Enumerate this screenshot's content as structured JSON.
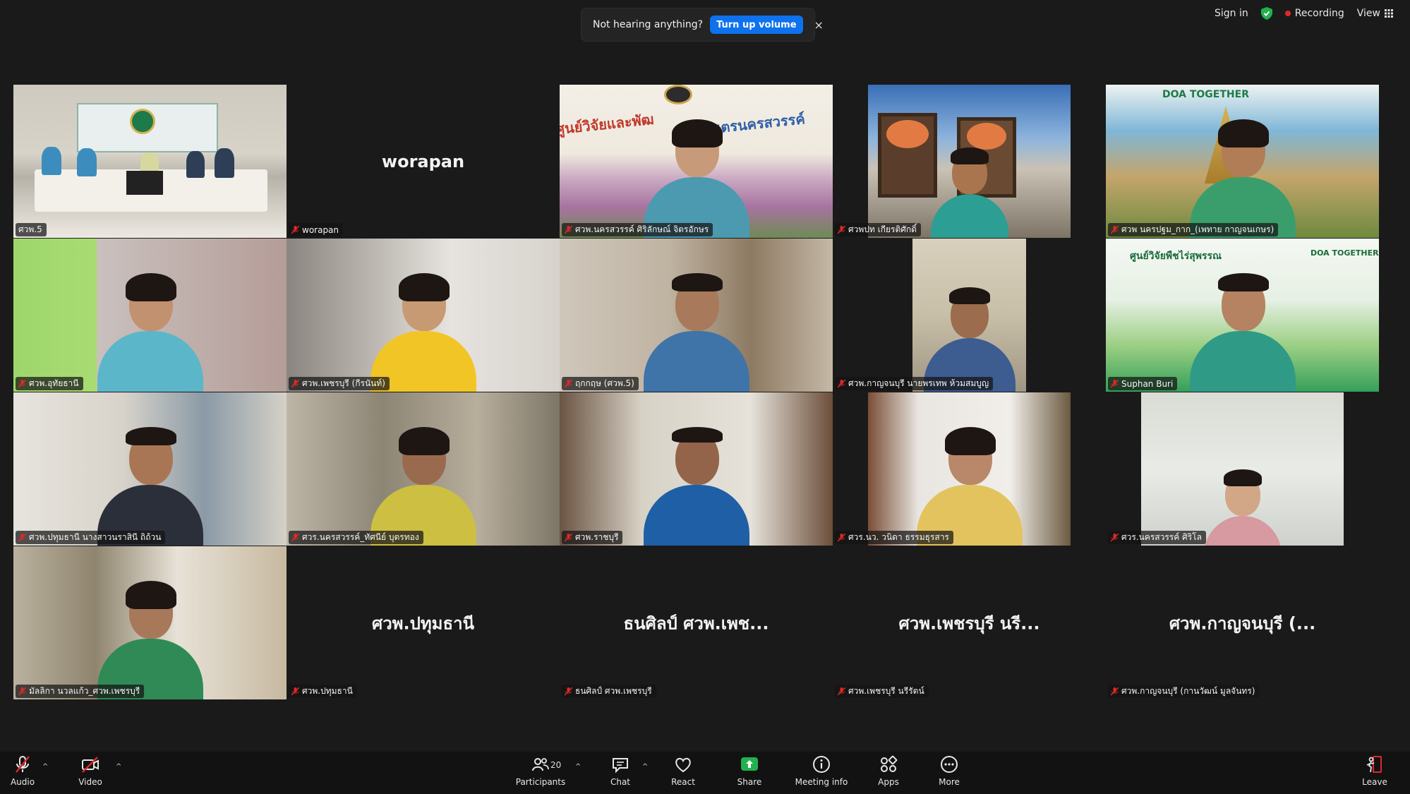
{
  "colors": {
    "accent": "#0e72ed",
    "active_speaker": "#34d058",
    "recording": "#e02828",
    "secure": "#23b14d",
    "mic_off": "#e02828",
    "share": "#23b14d",
    "leave": "#e02828"
  },
  "top_bar": {
    "sign_in": "Sign in",
    "recording": "Recording",
    "view": "View",
    "secure_icon": "shield-check-icon",
    "view_icon": "grid-icon"
  },
  "toast": {
    "message": "Not hearing anything?",
    "button": "Turn up volume",
    "close": "×"
  },
  "tiles": [
    {
      "label": "ศวพ.5",
      "type": "video",
      "active": true,
      "muted": false
    },
    {
      "label": "worapan",
      "type": "name",
      "display": "worapan",
      "muted": true
    },
    {
      "label": "ศวพ.นครสวรรค์ ศิริลักษณ์ จิตรอักษร",
      "type": "video",
      "banner": "ศูนย์วิจัยและพัฒ",
      "banner2": "เกษตรนครสวรรค์",
      "muted": true
    },
    {
      "label": "ศวพปท เกียรติศักดิ์",
      "type": "video",
      "muted": true
    },
    {
      "label": "ศวพ นครปฐม_กาก_(เพทาย กาญจนเกษร)",
      "type": "video",
      "banner": "DOA TOGETHER",
      "muted": true
    },
    {
      "label": "ศวพ.อุทัยธานี",
      "type": "video",
      "muted": true
    },
    {
      "label": "ศวพ.เพชรบุรี (กีรนันท์)",
      "type": "video",
      "muted": true
    },
    {
      "label": "ฤกกฤษ (ศวพ.5)",
      "type": "video",
      "muted": true
    },
    {
      "label": "ศวพ.กาญจนบุรี นายพรเทพ ห้วมสมบูญ",
      "type": "video",
      "muted": true
    },
    {
      "label": "Suphan Buri",
      "type": "video",
      "banner": "ศูนย์วิจัยพืชไร่สุพรรณ",
      "banner2": "DOA TOGETHER",
      "muted": true
    },
    {
      "label": "ศวพ.ปทุมธานี นางสาวนราสินี ถิถ้วน",
      "type": "video",
      "muted": true
    },
    {
      "label": "ศวร.นครสวรรค์_ทัศนีย์ บุตรทอง",
      "type": "video",
      "muted": true
    },
    {
      "label": "ศวพ.ราชบุรี",
      "type": "video",
      "muted": true
    },
    {
      "label": "ศวร.นว. วนิดา ธรรมธุรสาร",
      "type": "video",
      "muted": true
    },
    {
      "label": "ศวร.นครสวรรค์ ศิริโล",
      "type": "video",
      "muted": true
    },
    {
      "label": "มัลลิกา นวลแก้ว_ศวพ.เพชรบุรี",
      "type": "video",
      "muted": true
    },
    {
      "label": "ศวพ.ปทุมธานี",
      "type": "name",
      "display": "ศวพ.ปทุมธานี",
      "muted": true
    },
    {
      "label": "ธนศิลป์ ศวพ.เพชรบุรี",
      "type": "name",
      "display": "ธนศิลป์ ศวพ.เพช...",
      "muted": true
    },
    {
      "label": "ศวพ.เพชรบุรี นรีรัตน์",
      "type": "name",
      "display": "ศวพ.เพชรบุรี นรี...",
      "muted": true
    },
    {
      "label": "ศวพ.กาญจนบุรี (กานวัฒน์ มูลจันทร)",
      "type": "name",
      "display": "ศวพ.กาญจนบุรี (...",
      "muted": true
    }
  ],
  "toolbar": {
    "audio": "Audio",
    "video": "Video",
    "participants": "Participants",
    "participants_count": "20",
    "chat": "Chat",
    "react": "React",
    "share": "Share",
    "meeting_info": "Meeting info",
    "apps": "Apps",
    "more": "More",
    "leave": "Leave"
  }
}
